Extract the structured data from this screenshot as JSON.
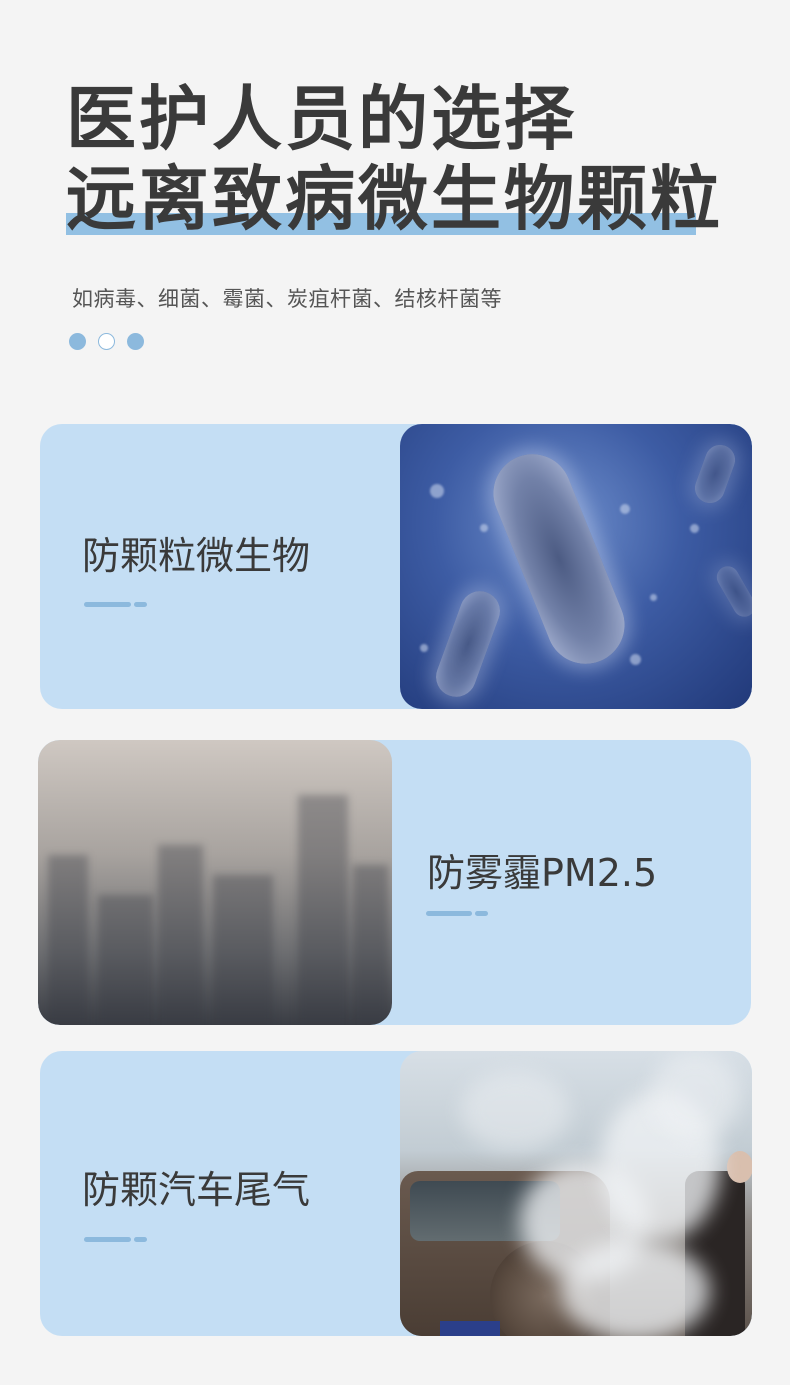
{
  "header": {
    "title_line1": "医护人员的选择",
    "title_line2": "远离致病微生物颗粒",
    "subtitle": "如病毒、细菌、霉菌、炭疽杆菌、结核杆菌等",
    "dots": [
      "filled",
      "hollow",
      "filled"
    ],
    "accent_color": "#8cb9dd"
  },
  "cards": [
    {
      "title": "防颗粒微生物",
      "image": "bacteria-photo"
    },
    {
      "title": "防雾霾PM2.5",
      "image": "smog-city-photo"
    },
    {
      "title": "防颗汽车尾气",
      "image": "car-exhaust-photo"
    }
  ],
  "colors": {
    "page_background": "#f4f4f4",
    "card_background": "#c4def4",
    "highlight_bar": "#92c0e3",
    "title_text": "#3a3a3a"
  }
}
